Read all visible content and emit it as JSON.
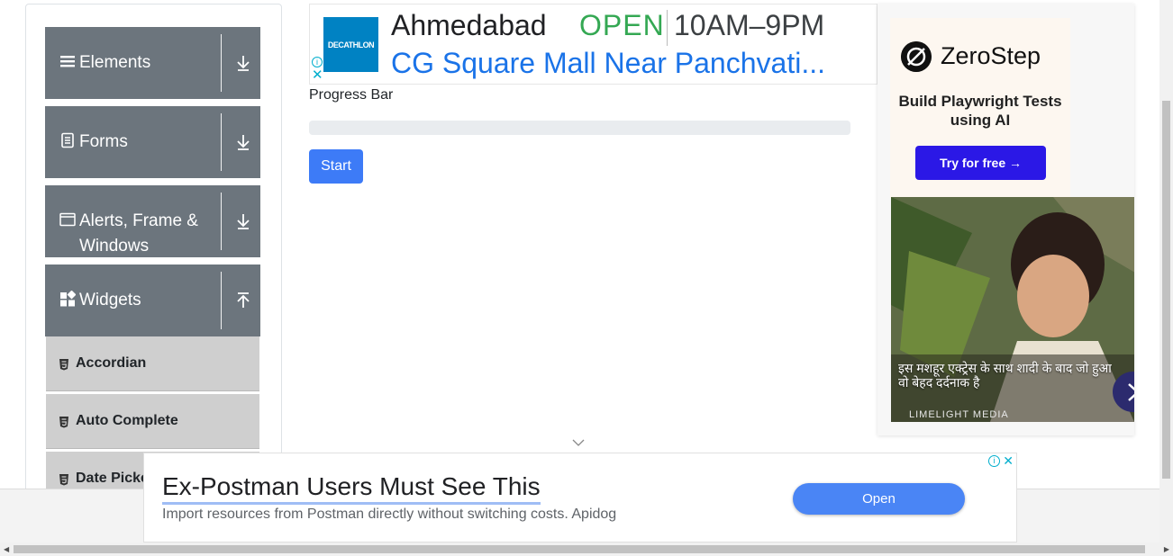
{
  "sidebar": {
    "groups": [
      {
        "label": "Elements",
        "icon": "hamburger-icon",
        "arrow": "download-arrow-icon"
      },
      {
        "label": "Forms",
        "icon": "document-icon",
        "arrow": "download-arrow-icon"
      },
      {
        "label": "Alerts, Frame & Windows",
        "icon": "window-icon",
        "arrow": "download-arrow-icon"
      },
      {
        "label": "Widgets",
        "icon": "widgets-icon",
        "arrow": "upload-arrow-icon"
      }
    ],
    "subitems": [
      {
        "label": "Accordian",
        "icon": "html5-shield-icon"
      },
      {
        "label": "Auto Complete",
        "icon": "html5-shield-icon"
      },
      {
        "label": "Date Picker",
        "icon": "html5-shield-icon"
      }
    ]
  },
  "top_ad": {
    "brand": "DECATHLON",
    "city": "Ahmedabad",
    "status": "OPEN",
    "hours": "10AM–9PM",
    "address": "CG Square Mall Near Panchvati...",
    "info": "i",
    "close": "✕"
  },
  "main": {
    "progress_label": "Progress Bar",
    "progress_value": 0,
    "start_label": "Start"
  },
  "right_ad": {
    "brand": "ZeroStep",
    "tagline": "Build Playwright Tests using AI",
    "cta": "Try for free →",
    "caption": "इस मशहूर एक्ट्रेस के साथ शादी के बाद जो हुआ वो बेहद दर्दनाक है",
    "source": "LIMELIGHT MEDIA"
  },
  "bottom_ad": {
    "headline": "Ex-Postman Users Must See This",
    "description": "Import resources from Postman directly without switching costs. Apidog",
    "button": "Open",
    "info": "i",
    "close": "✕"
  },
  "colors": {
    "sidebar_header": "#6c757d",
    "sidebar_subitem": "#cfcfcf",
    "primary_button": "#3d7bf7",
    "open_green": "#34a853",
    "link_blue": "#1a73e8",
    "zerostep_button": "#2b18e6"
  }
}
